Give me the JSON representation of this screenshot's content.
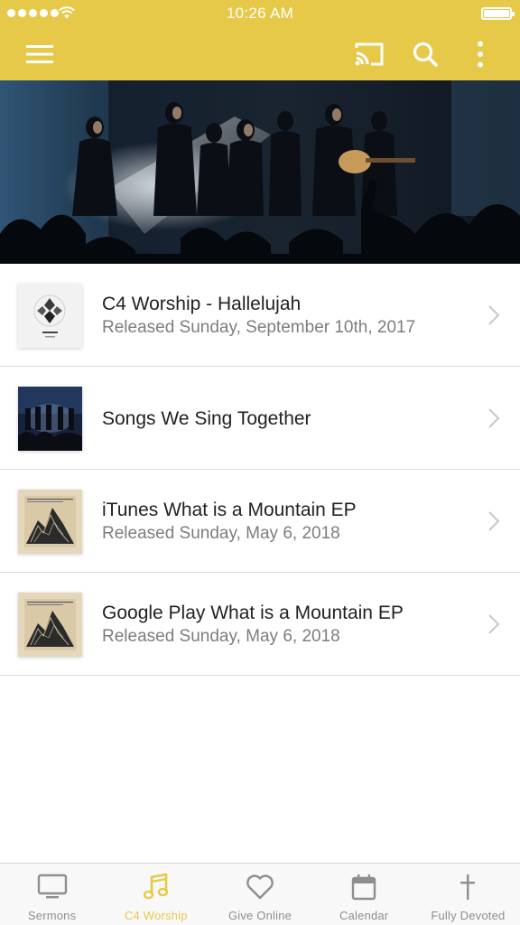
{
  "colors": {
    "accent": "#e7c94a",
    "tab_inactive": "#8e8e8e",
    "header_icons": "#ffffff"
  },
  "status_bar": {
    "time": "10:26 AM",
    "signal_icon": "signal-dots-icon",
    "wifi_icon": "wifi-icon",
    "battery_icon": "battery-icon"
  },
  "toolbar": {
    "menu_icon": "hamburger-menu-icon",
    "cast_icon": "cast-icon",
    "search_icon": "search-icon",
    "more_icon": "more-vertical-icon"
  },
  "hero": {
    "image": "worship-band-on-stage-photo"
  },
  "list": {
    "items": [
      {
        "title": "C4 Worship - Hallelujah",
        "subtitle": "Released Sunday, September 10th, 2017",
        "thumb": "hallelujah-album-art"
      },
      {
        "title": "Songs We Sing Together",
        "subtitle": "",
        "thumb": "band-stage-album-art"
      },
      {
        "title": "iTunes What is a Mountain EP",
        "subtitle": "Released Sunday, May 6, 2018",
        "thumb": "mountain-album-art"
      },
      {
        "title": "Google Play What is a Mountain EP",
        "subtitle": "Released Sunday, May 6, 2018",
        "thumb": "mountain-album-art"
      }
    ]
  },
  "tabbar": {
    "tabs": [
      {
        "label": "Sermons",
        "icon": "tv-icon",
        "active": false
      },
      {
        "label": "C4 Worship",
        "icon": "music-note-icon",
        "active": true
      },
      {
        "label": "Give Online",
        "icon": "heart-icon",
        "active": false
      },
      {
        "label": "Calendar",
        "icon": "calendar-icon",
        "active": false
      },
      {
        "label": "Fully Devoted",
        "icon": "cross-icon",
        "active": false
      }
    ]
  }
}
